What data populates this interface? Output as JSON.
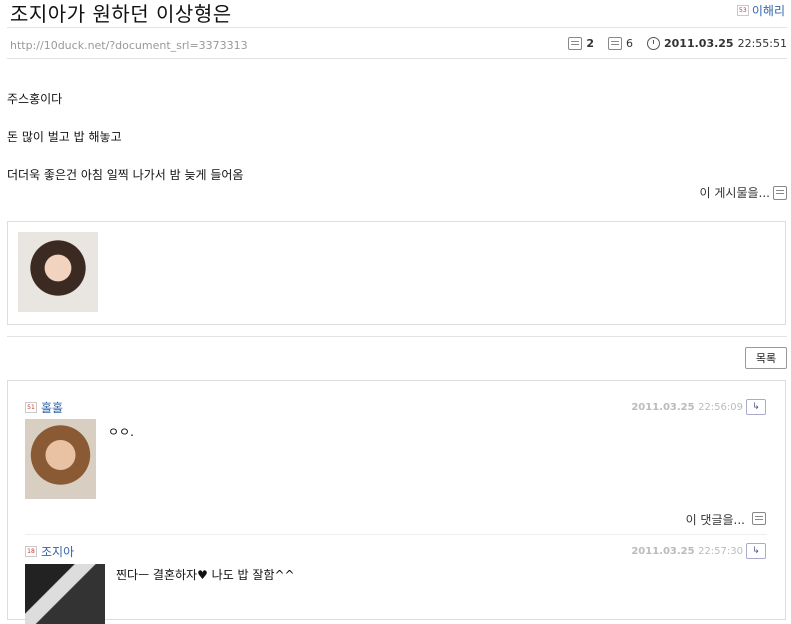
{
  "post": {
    "title": "조지아가 원하던 이상형은",
    "author": "이해리",
    "author_level": "53",
    "url": "http://10duck.net/?document_srl=3373313",
    "comments_count": "2",
    "views": "6",
    "date": "2011.03.25",
    "time": "22:55:51",
    "lines": [
      "주스홍이다",
      "돈 많이 벌고 밥 해놓고",
      "더더욱 좋은건 아침 일찍 나가서 밤 늦게 들어옴"
    ],
    "report_label": "이 게시물을..."
  },
  "list_button": "목록",
  "comments": [
    {
      "name": "홀홀",
      "level": "51",
      "date": "2011.03.25",
      "time": "22:56:09",
      "text": "ㅇㅇ.",
      "action_label": "이 댓글을..."
    },
    {
      "name": "조지아",
      "level": "18",
      "date": "2011.03.25",
      "time": "22:57:30",
      "text": "찐다ㅡ 결혼하자♥ 나도 밥 잘함^^"
    }
  ],
  "icons": [
    "comment-icon",
    "view-icon",
    "clock-icon",
    "report-icon",
    "reply-icon"
  ],
  "colors": {
    "link": "#3366aa",
    "muted": "#999999",
    "border": "#dddddd"
  }
}
